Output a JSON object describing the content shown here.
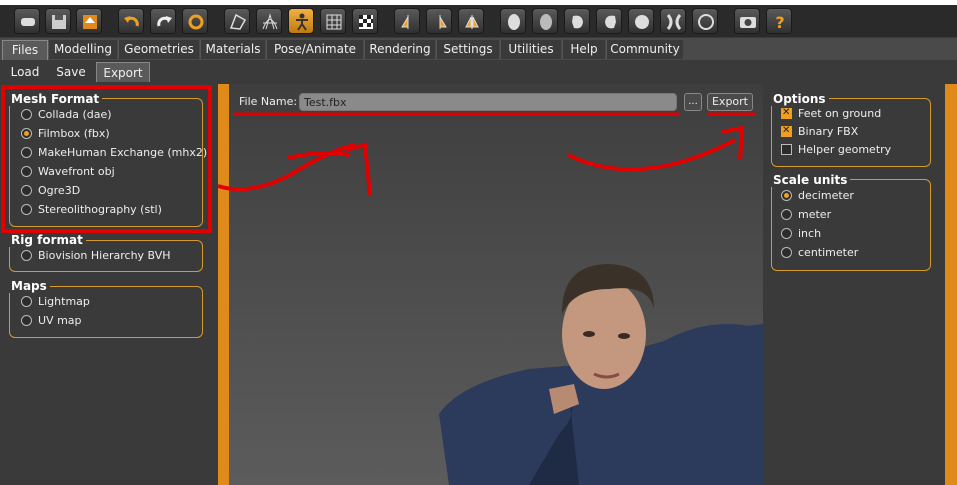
{
  "tabs": [
    "Files",
    "Modelling",
    "Geometries",
    "Materials",
    "Pose/Animate",
    "Rendering",
    "Settings",
    "Utilities",
    "Help",
    "Community"
  ],
  "subtabs": [
    "Load",
    "Save",
    "Export"
  ],
  "mesh_format": {
    "title": "Mesh Format",
    "options": [
      "Collada (dae)",
      "Filmbox (fbx)",
      "MakeHuman Exchange (mhx2)",
      "Wavefront obj",
      "Ogre3D",
      "Stereolithography (stl)"
    ],
    "selected": "Filmbox (fbx)"
  },
  "rig_format": {
    "title": "Rig format",
    "options": [
      "Biovision Hierarchy BVH"
    ]
  },
  "maps": {
    "title": "Maps",
    "options": [
      "Lightmap",
      "UV map"
    ]
  },
  "file": {
    "label": "File Name:",
    "value": "Test.fbx",
    "browse_label": "...",
    "export_label": "Export"
  },
  "options": {
    "title": "Options",
    "items": [
      {
        "label": "Feet on ground",
        "checked": true
      },
      {
        "label": "Binary FBX",
        "checked": true
      },
      {
        "label": "Helper geometry",
        "checked": false
      }
    ]
  },
  "scale_units": {
    "title": "Scale units",
    "options": [
      "decimeter",
      "meter",
      "inch",
      "centimeter"
    ],
    "selected": "decimeter"
  },
  "colors": {
    "accent": "#e08a1a",
    "annotation": "#e00000"
  }
}
